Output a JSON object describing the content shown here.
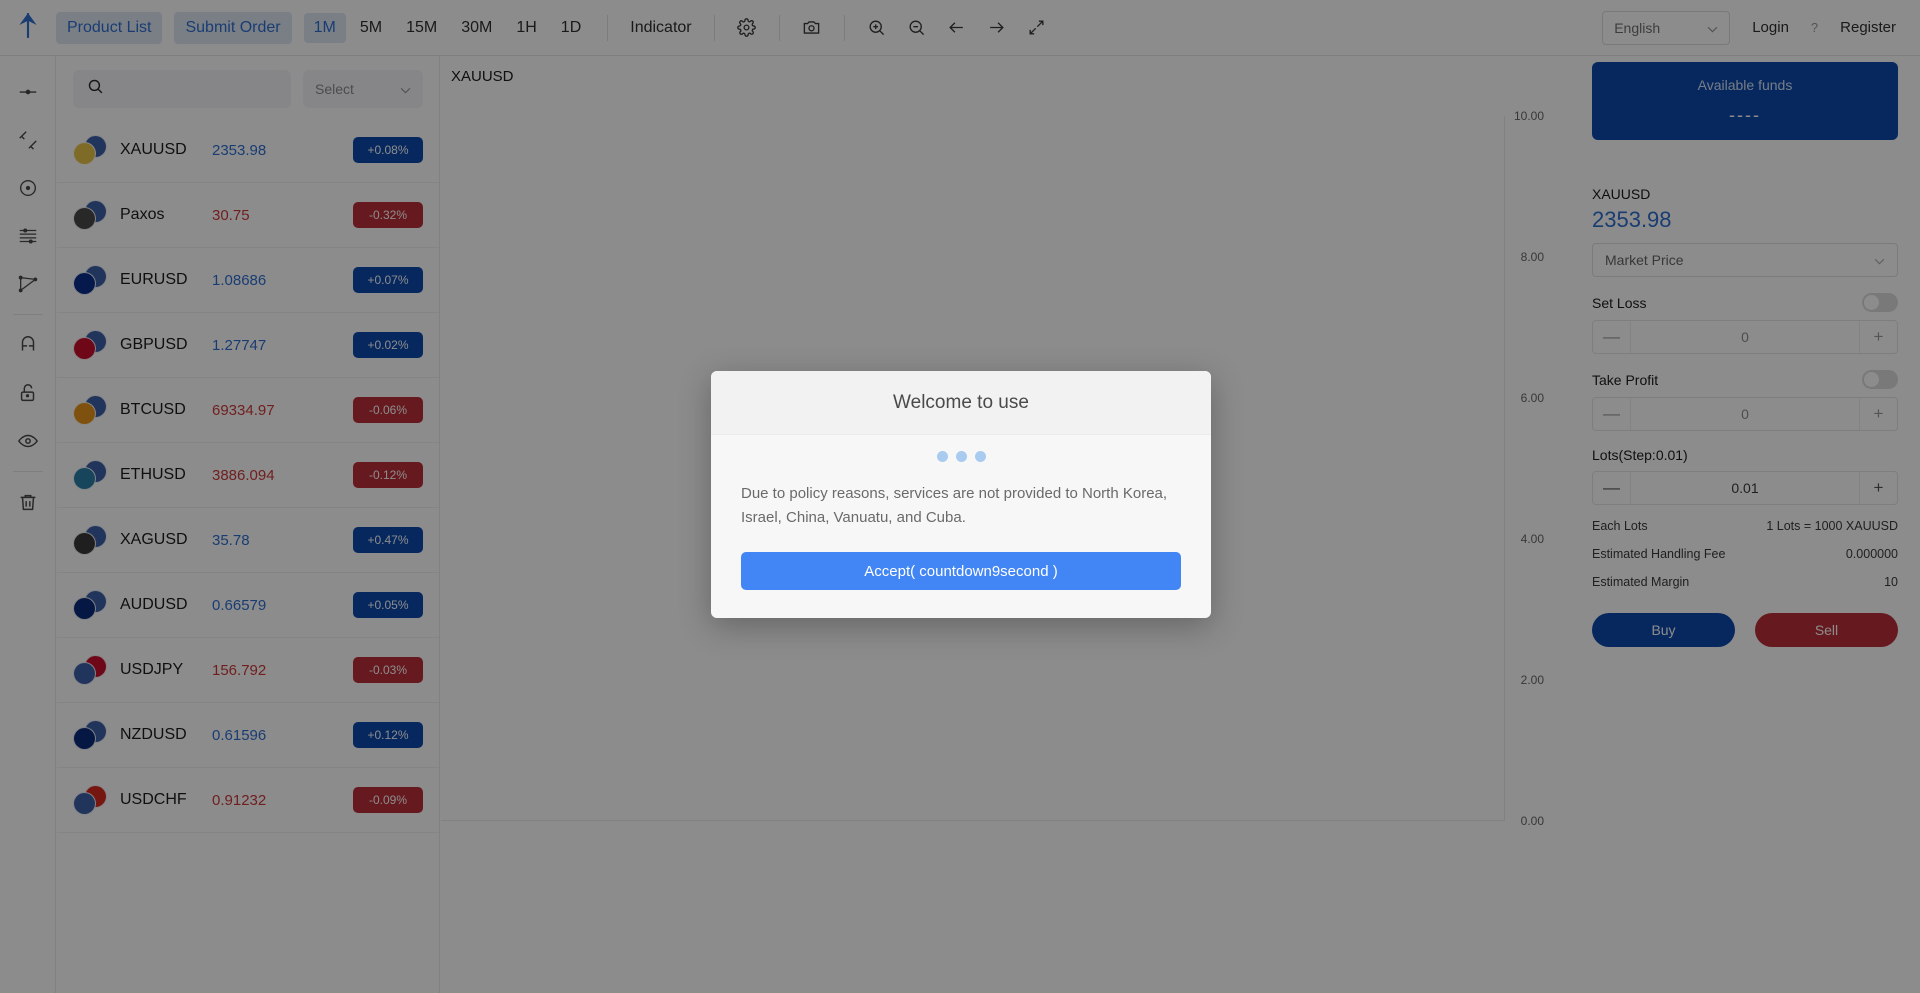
{
  "toolbar": {
    "logo_icon": "up-arrow-logo",
    "product_list": "Product List",
    "submit_order": "Submit Order",
    "timeframes": [
      {
        "label": "1M",
        "active": true
      },
      {
        "label": "5M",
        "active": false
      },
      {
        "label": "15M",
        "active": false
      },
      {
        "label": "30M",
        "active": false
      },
      {
        "label": "1H",
        "active": false
      },
      {
        "label": "1D",
        "active": false
      }
    ],
    "indicator": "Indicator",
    "icons": [
      "gear-icon",
      "camera-icon",
      "zoom-in-icon",
      "zoom-out-icon",
      "arrow-left-icon",
      "arrow-right-icon",
      "expand-icon"
    ],
    "language": "English",
    "login": "Login",
    "separator": "?",
    "register": "Register"
  },
  "rail": {
    "icons": [
      "crosshair-line-icon",
      "trend-lines-icon",
      "circle-target-icon",
      "horizontal-lines-icon",
      "shape-polygon-icon",
      "magnet-icon",
      "unlock-icon",
      "eye-icon",
      "trash-icon"
    ]
  },
  "products": {
    "search_placeholder": "",
    "select_label": "Select",
    "rows": [
      {
        "name": "XAUUSD",
        "price": "2353.98",
        "change": "+0.08%",
        "dir": "up",
        "back": "#3c5fa8",
        "front": "#e8c44a"
      },
      {
        "name": "Paxos",
        "price": "30.75",
        "change": "-0.32%",
        "dir": "down",
        "back": "#3c5fa8",
        "front": "#4a4a4a"
      },
      {
        "name": "EURUSD",
        "price": "1.08686",
        "change": "+0.07%",
        "dir": "up",
        "back": "#3c5fa8",
        "front": "#0a2e8c"
      },
      {
        "name": "GBPUSD",
        "price": "1.27747",
        "change": "+0.02%",
        "dir": "up",
        "back": "#3c5fa8",
        "front": "#c8102e"
      },
      {
        "name": "BTCUSD",
        "price": "69334.97",
        "change": "-0.06%",
        "dir": "down",
        "back": "#3c5fa8",
        "front": "#e8941a"
      },
      {
        "name": "ETHUSD",
        "price": "3886.094",
        "change": "-0.12%",
        "dir": "down",
        "back": "#3c5fa8",
        "front": "#2b7fa8"
      },
      {
        "name": "XAGUSD",
        "price": "35.78",
        "change": "+0.47%",
        "dir": "up",
        "back": "#3c5fa8",
        "front": "#3a3a3a"
      },
      {
        "name": "AUDUSD",
        "price": "0.66579",
        "change": "+0.05%",
        "dir": "up",
        "back": "#3c5fa8",
        "front": "#0a2a7a"
      },
      {
        "name": "USDJPY",
        "price": "156.792",
        "change": "-0.03%",
        "dir": "down",
        "back": "#c8102e",
        "front": "#3c5fa8"
      },
      {
        "name": "NZDUSD",
        "price": "0.61596",
        "change": "+0.12%",
        "dir": "up",
        "back": "#3c5fa8",
        "front": "#0a2a7a"
      },
      {
        "name": "USDCHF",
        "price": "0.91232",
        "change": "-0.09%",
        "dir": "down",
        "back": "#d52b1e",
        "front": "#3c5fa8"
      }
    ]
  },
  "chart": {
    "symbol": "XAUUSD"
  },
  "chart_data": {
    "type": "line",
    "title": "XAUUSD",
    "xlabel": "",
    "ylabel": "",
    "ylim": [
      0.0,
      10.0
    ],
    "yticks": [
      "10.00",
      "8.00",
      "6.00",
      "4.00",
      "2.00",
      "0.00"
    ],
    "grid": false,
    "series": [
      {
        "name": "XAUUSD",
        "values": []
      }
    ],
    "x": []
  },
  "order": {
    "funds_label": "Available funds",
    "funds_value": "----",
    "symbol": "XAUUSD",
    "price": "2353.98",
    "order_type": "Market Price",
    "set_loss_label": "Set Loss",
    "set_loss_value": "0",
    "take_profit_label": "Take Profit",
    "take_profit_value": "0",
    "lots_label": "Lots(Step:0.01)",
    "lots_value": "0.01",
    "minus": "—",
    "plus": "+",
    "info": [
      {
        "key": "Each Lots",
        "value": "1 Lots = 1000 XAUUSD"
      },
      {
        "key": "Estimated Handling Fee",
        "value": "0.000000"
      },
      {
        "key": "Estimated Margin",
        "value": "10"
      }
    ],
    "buy": "Buy",
    "sell": "Sell"
  },
  "modal": {
    "title": "Welcome to use",
    "text": "Due to policy reasons, services are not provided to North Korea, Israel, China, Vanuatu, and Cuba.",
    "accept": "Accept( countdown9second )"
  }
}
